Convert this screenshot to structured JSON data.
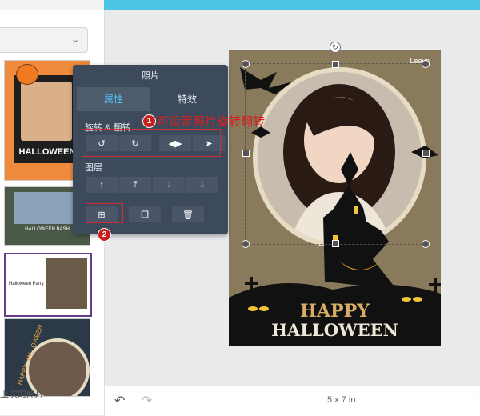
{
  "app": {
    "accent": "#4cc6e4"
  },
  "left_panel": {
    "thumbnails": [
      {
        "caption": "HALLOWEEN"
      },
      {
        "caption": "HALLOWEEN BASH"
      },
      {
        "caption": "Halloween Party"
      },
      {
        "caption": "HAPPY HALLOWEEN"
      }
    ],
    "last_photos_label": "上次的照片"
  },
  "photo_panel": {
    "title": "照片",
    "tabs": [
      "属性",
      "特效"
    ],
    "rotate_flip_label": "旋转 & 翻转",
    "layer_label": "图层"
  },
  "annotations": {
    "note1_badge": "1",
    "note1_text": "可设置照片旋转翻转",
    "note2_badge": "2"
  },
  "canvas": {
    "watermark": "Leave",
    "happy": "HAPPY",
    "halloween": "HALLOWEEN"
  },
  "bottom_bar": {
    "size": "5 x 7 in",
    "zoom_minus": "−"
  }
}
